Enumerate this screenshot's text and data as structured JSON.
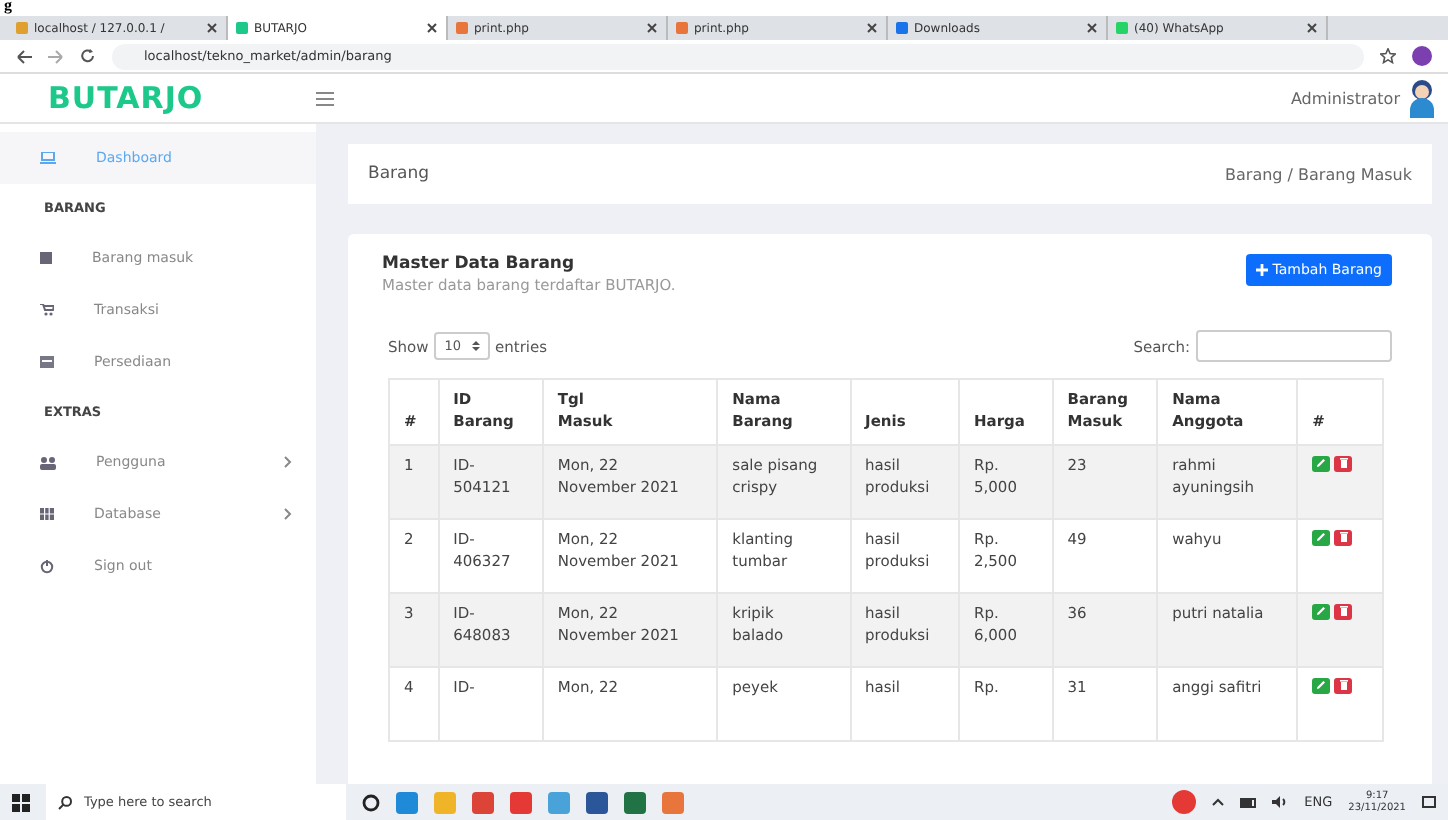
{
  "fragment": "g",
  "browser": {
    "tabs": [
      {
        "label": "localhost / 127.0.0.1 / ",
        "selected": false
      },
      {
        "label": "BUTARJO",
        "selected": true
      },
      {
        "label": "print.php",
        "selected": false
      },
      {
        "label": "print.php",
        "selected": false
      },
      {
        "label": "Downloads",
        "selected": false
      },
      {
        "label": "(40) WhatsApp",
        "selected": false
      }
    ],
    "address": "localhost/tekno_market/admin/barang"
  },
  "header": {
    "logo": "BUTARJO",
    "user": "Administrator"
  },
  "sidebar": [
    {
      "kind": "item",
      "label": "Dashboard",
      "selected": true,
      "expandable": false
    },
    {
      "kind": "section",
      "label": "BARANG"
    },
    {
      "kind": "item",
      "label": "Barang masuk",
      "selected": false,
      "expandable": false
    },
    {
      "kind": "item",
      "label": "Transaksi",
      "selected": false,
      "expandable": false
    },
    {
      "kind": "item",
      "label": "Persediaan",
      "selected": false,
      "expandable": false
    },
    {
      "kind": "section",
      "label": "EXTRAS"
    },
    {
      "kind": "item",
      "label": "Pengguna",
      "selected": false,
      "expandable": true
    },
    {
      "kind": "item",
      "label": "Database",
      "selected": false,
      "expandable": true
    },
    {
      "kind": "item",
      "label": "Sign out",
      "selected": false,
      "expandable": false
    }
  ],
  "page_title": "Barang",
  "breadcrumb": "Barang / Barang Masuk",
  "card": {
    "title": "Master Data Barang",
    "subtitle": "Master data barang terdaftar BUTARJO.",
    "add_button": "Tambah Barang",
    "show_label": "Show",
    "entries_value": "10",
    "entries_label": "entries",
    "search_label": "Search:"
  },
  "table": {
    "columns": [
      "#",
      "ID Barang",
      "Tgl Masuk",
      "Nama Barang",
      "Jenis",
      "Harga",
      "Barang Masuk",
      "Nama Anggota",
      "#"
    ],
    "rows": [
      {
        "cells": [
          "1",
          "ID-\n504121",
          "Mon, 22\nNovember 2021",
          "sale pisang\ncrispy",
          "hasil\nproduksi",
          "Rp.\n5,000",
          "23",
          "rahmi\nayuningsih"
        ]
      },
      {
        "cells": [
          "2",
          "ID-\n406327",
          "Mon, 22\nNovember 2021",
          "klanting\ntumbar",
          "hasil\nproduksi",
          "Rp.\n2,500",
          "49",
          "wahyu"
        ]
      },
      {
        "cells": [
          "3",
          "ID-\n648083",
          "Mon, 22\nNovember 2021",
          "kripik\nbalado",
          "hasil\nproduksi",
          "Rp.\n6,000",
          "36",
          "putri natalia"
        ]
      },
      {
        "cells": [
          "4",
          "ID-",
          "Mon, 22",
          "peyek",
          "hasil",
          "Rp.",
          "31",
          "anggi safitri"
        ]
      }
    ]
  },
  "taskbar": {
    "search_placeholder": "Type here to search",
    "language": "ENG",
    "time": "9:17",
    "date": "23/11/2021"
  }
}
